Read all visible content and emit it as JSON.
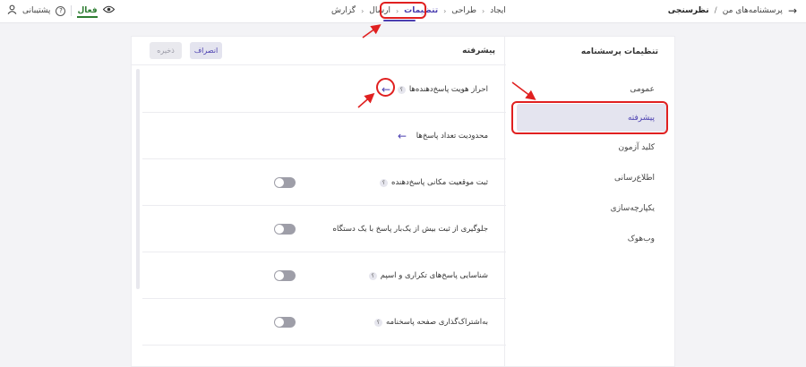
{
  "topbar": {
    "breadcrumb": {
      "root": "پرسشنامه‌های من",
      "separator": "/",
      "current": "نظرسنجی"
    },
    "steps": [
      {
        "label": "ایجاد",
        "active": false
      },
      {
        "label": "طراحی",
        "active": false
      },
      {
        "label": "تنظیمات",
        "active": true
      },
      {
        "label": "ارسال",
        "active": false
      },
      {
        "label": "گزارش",
        "active": false
      }
    ],
    "status_label": "فعال",
    "support_label": "پشتیبانی"
  },
  "sidebar": {
    "title": "تنظیمات پرسشنامه",
    "items": [
      {
        "label": "عمومی",
        "active": false
      },
      {
        "label": "پیشرفته",
        "active": true
      },
      {
        "label": "کلید آزمون",
        "active": false
      },
      {
        "label": "اطلاع‌رسانی",
        "active": false
      },
      {
        "label": "یکپارچه‌سازی",
        "active": false
      },
      {
        "label": "وب‌هوک",
        "active": false
      }
    ]
  },
  "content": {
    "title": "پیشرفته",
    "cancel_label": "انصراف",
    "save_label": "ذخیره",
    "rows": [
      {
        "label": "احراز هویت پاسخ‌دهنده‌ها",
        "help": "؟",
        "control": "arrow"
      },
      {
        "label": "محدودیت تعداد پاسخ‌ها",
        "help": "",
        "control": "arrow"
      },
      {
        "label": "ثبت موقعیت مکانی پاسخ‌دهنده",
        "help": "؟",
        "control": "toggle",
        "enabled": false
      },
      {
        "label": "جلوگیری از ثبت بیش از یک‌بار پاسخ با یک دستگاه",
        "help": "",
        "control": "toggle",
        "enabled": false
      },
      {
        "label": "شناسایی پاسخ‌های تکراری و اسپم",
        "help": "؟",
        "control": "toggle",
        "enabled": false
      },
      {
        "label": "به‌اشتراک‌گذاری صفحه پاسخنامه",
        "help": "؟",
        "control": "toggle",
        "enabled": false
      }
    ]
  },
  "icons": {
    "back": "arrow-right-icon",
    "preview": "eye-icon",
    "help": "question-circle-icon",
    "user": "user-icon",
    "row_arrow": "arrow-left-icon"
  },
  "colors": {
    "accent": "#4b3fb0",
    "active_bg": "#e4e4ef",
    "status_green": "#2e7d32",
    "annotation_red": "#e02020",
    "toggle_off": "#9e9ea8"
  }
}
